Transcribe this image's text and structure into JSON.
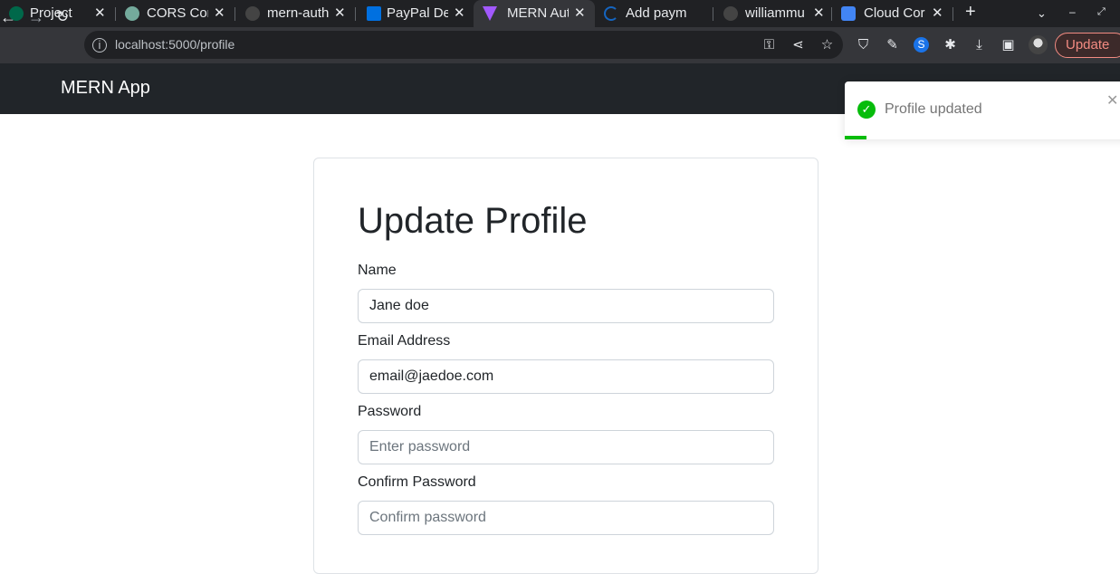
{
  "browser": {
    "tabs": [
      {
        "title": "Project Ov",
        "favicon_color": "#00684a"
      },
      {
        "title": "CORS Con",
        "favicon_color": "#74aa9c"
      },
      {
        "title": "mern-auth",
        "favicon_color": "#444"
      },
      {
        "title": "PayPal De",
        "favicon_color": "#0070e0"
      },
      {
        "title": "MERN Aut",
        "favicon_color": "#a259ff"
      },
      {
        "title": "Add paym",
        "favicon_color": "#1565c0"
      },
      {
        "title": "williammu",
        "favicon_color": "#444"
      },
      {
        "title": "Cloud Cor",
        "favicon_color": "#4285f4"
      }
    ],
    "url": "localhost:5000/profile",
    "update_label": "Update"
  },
  "app": {
    "brand": "MERN App"
  },
  "form": {
    "title": "Update Profile",
    "name_label": "Name",
    "name_value": "Jane doe",
    "email_label": "Email Address",
    "email_value": "email@jaedoe.com",
    "password_label": "Password",
    "password_placeholder": "Enter password",
    "confirm_label": "Confirm Password",
    "confirm_placeholder": "Confirm password"
  },
  "toast": {
    "message": "Profile updated",
    "status_color": "#07bc0c"
  }
}
